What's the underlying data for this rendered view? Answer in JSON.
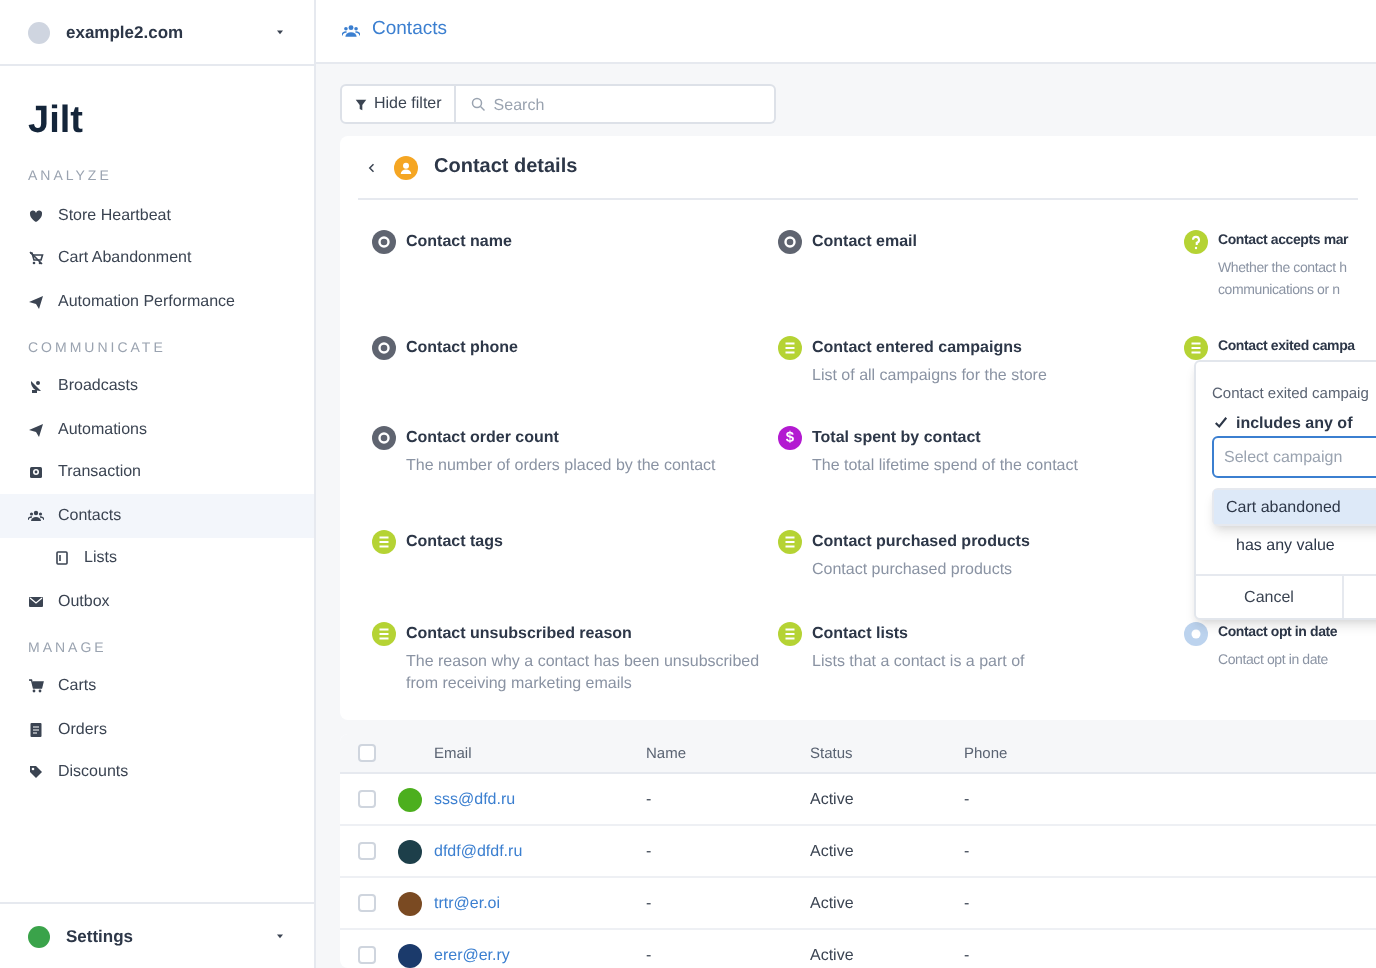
{
  "account": {
    "name": "example2.com"
  },
  "logo": "Jilt",
  "sidebar": {
    "sections": [
      {
        "heading": "ANALYZE",
        "items": [
          {
            "label": "Store Heartbeat",
            "kind": "heart",
            "selected": false
          },
          {
            "label": "Cart Abandonment",
            "kind": "cart-off",
            "selected": false
          },
          {
            "label": "Automation Performance",
            "kind": "plane",
            "selected": false
          }
        ]
      },
      {
        "heading": "COMMUNICATE",
        "items": [
          {
            "label": "Broadcasts",
            "kind": "dish",
            "selected": false
          },
          {
            "label": "Automations",
            "kind": "plane",
            "selected": false
          },
          {
            "label": "Transaction",
            "kind": "inbox",
            "selected": false
          },
          {
            "label": "Contacts",
            "kind": "people",
            "selected": true,
            "children": [
              {
                "label": "Lists",
                "kind": "list",
                "selected": false
              }
            ]
          },
          {
            "label": "Outbox",
            "kind": "mail",
            "selected": false
          }
        ]
      },
      {
        "heading": "MANAGE",
        "items": [
          {
            "label": "Carts",
            "kind": "cart",
            "selected": false
          },
          {
            "label": "Orders",
            "kind": "doc",
            "selected": false
          },
          {
            "label": "Discounts",
            "kind": "tag",
            "selected": false
          }
        ]
      }
    ]
  },
  "settings": {
    "label": "Settings"
  },
  "header": {
    "title": "Contacts"
  },
  "filter": {
    "button": "Hide filter",
    "search": {
      "placeholder": "Search"
    }
  },
  "details": {
    "title": "Contact details",
    "rows": [
      [
        {
          "title": "Contact name",
          "kind": "gear",
          "color": "#5f6470"
        },
        {
          "title": "Contact email",
          "kind": "gear",
          "color": "#5f6470"
        },
        {
          "title": "Contact accepts mar",
          "description": [
            "Whether the contact h",
            "communications or n"
          ],
          "kind": "question",
          "color": "#b5d334"
        }
      ],
      [
        {
          "title": "Contact phone",
          "kind": "gear",
          "color": "#5f6470"
        },
        {
          "title": "Contact entered campaigns",
          "description": [
            "List of all campaigns for the store"
          ],
          "kind": "list",
          "color": "#b5d334"
        },
        {
          "title": "Contact exited campa",
          "kind": "list",
          "color": "#b5d334"
        }
      ],
      [
        {
          "title": "Contact order count",
          "description": [
            "The number of orders placed by the contact"
          ],
          "kind": "gear",
          "color": "#5f6470"
        },
        {
          "title": "Total spent by contact",
          "description": [
            "The total lifetime spend of the contact"
          ],
          "kind": "dollar",
          "glyph": "$",
          "color": "#b31ad1"
        }
      ],
      [
        {
          "title": "Contact tags",
          "kind": "list",
          "color": "#b5d334"
        },
        {
          "title": "Contact purchased products",
          "description": [
            "Contact purchased products"
          ],
          "kind": "list",
          "color": "#b5d334"
        }
      ],
      [
        {
          "title": "Contact unsubscribed reason",
          "description": [
            "The reason why a contact has been unsubscribed",
            "from receiving marketing emails"
          ],
          "kind": "list",
          "color": "#b5d334"
        },
        {
          "title": "Contact lists",
          "description": [
            "Lists that a contact is a part of"
          ],
          "kind": "list",
          "color": "#b5d334"
        },
        {
          "title": "Contact opt in date",
          "description": [
            "Contact opt in date"
          ],
          "kind": "date",
          "color": "#bcd3ee"
        }
      ]
    ]
  },
  "popup": {
    "title": "Contact exited campaig",
    "options": [
      {
        "label": "includes any of",
        "checked": true
      },
      {
        "label": "has any value",
        "checked": false
      }
    ],
    "select": {
      "placeholder": "Select campaign"
    },
    "suggestions": [
      {
        "label": "Cart abandoned",
        "selected": true
      }
    ],
    "cancel": "Cancel"
  },
  "table": {
    "select_all": {
      "checked": false
    },
    "columns": [
      "Email",
      "Name",
      "Status",
      "Phone"
    ],
    "rows": [
      {
        "email": "sss@dfd.ru",
        "name": "-",
        "status": "Active",
        "phone": "-",
        "color": "#4caf1e",
        "checked": false
      },
      {
        "email": "dfdf@dfdf.ru",
        "name": "-",
        "status": "Active",
        "phone": "-",
        "color": "#1d3f4a",
        "checked": false
      },
      {
        "email": "trtr@er.oi",
        "name": "-",
        "status": "Active",
        "phone": "-",
        "color": "#7a4a22",
        "checked": false
      },
      {
        "email": "erer@er.ry",
        "name": "-",
        "status": "Active",
        "phone": "-",
        "color": "#1b3a6b",
        "checked": false
      }
    ]
  }
}
